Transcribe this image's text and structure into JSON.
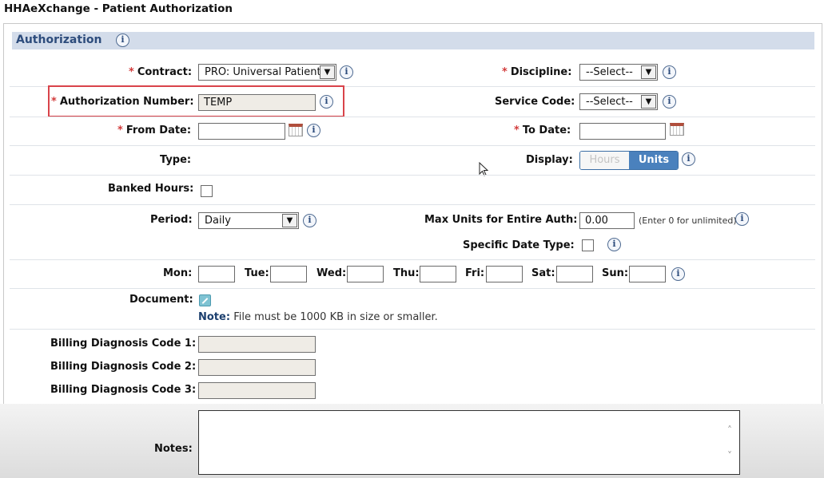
{
  "window": {
    "title": "HHAeXchange - Patient Authorization"
  },
  "section": {
    "title": "Authorization",
    "info_icon": "info-icon"
  },
  "fields": {
    "contract": {
      "label": "Contract:",
      "value": "PRO: Universal Patient"
    },
    "discipline": {
      "label": "Discipline:",
      "value": "--Select--"
    },
    "authorization_number": {
      "label": "Authorization Number:",
      "value": "TEMP"
    },
    "service_code": {
      "label": "Service Code:",
      "value": "--Select--"
    },
    "from_date": {
      "label": "From Date:",
      "value": ""
    },
    "to_date": {
      "label": "To Date:",
      "value": ""
    },
    "type": {
      "label": "Type:"
    },
    "display": {
      "label": "Display:",
      "options": [
        "Hours",
        "Units"
      ],
      "selected": "Units"
    },
    "banked_hours": {
      "label": "Banked Hours:",
      "checked": false
    },
    "period": {
      "label": "Period:",
      "value": "Daily"
    },
    "max_units": {
      "label": "Max Units for Entire Auth:",
      "value": "0.00",
      "hint": "(Enter 0 for unlimited)"
    },
    "specific_date_type": {
      "label": "Specific Date Type:",
      "checked": false
    },
    "days": [
      {
        "label": "Mon:",
        "value": ""
      },
      {
        "label": "Tue:",
        "value": ""
      },
      {
        "label": "Wed:",
        "value": ""
      },
      {
        "label": "Thu:",
        "value": ""
      },
      {
        "label": "Fri:",
        "value": ""
      },
      {
        "label": "Sat:",
        "value": ""
      },
      {
        "label": "Sun:",
        "value": ""
      }
    ],
    "document": {
      "label": "Document:",
      "note_label": "Note:",
      "note_text": "File must be 1000 KB in size or smaller."
    },
    "billing_codes": [
      {
        "label": "Billing Diagnosis Code 1:",
        "value": ""
      },
      {
        "label": "Billing Diagnosis Code 2:",
        "value": ""
      },
      {
        "label": "Billing Diagnosis Code 3:",
        "value": ""
      }
    ],
    "notes": {
      "label": "Notes:",
      "value": ""
    }
  },
  "required_marker": "*",
  "colors": {
    "accent": "#4a81bd",
    "header_bg": "#d3dcea",
    "required": "#d23b3b",
    "highlight": "#d9434a"
  }
}
